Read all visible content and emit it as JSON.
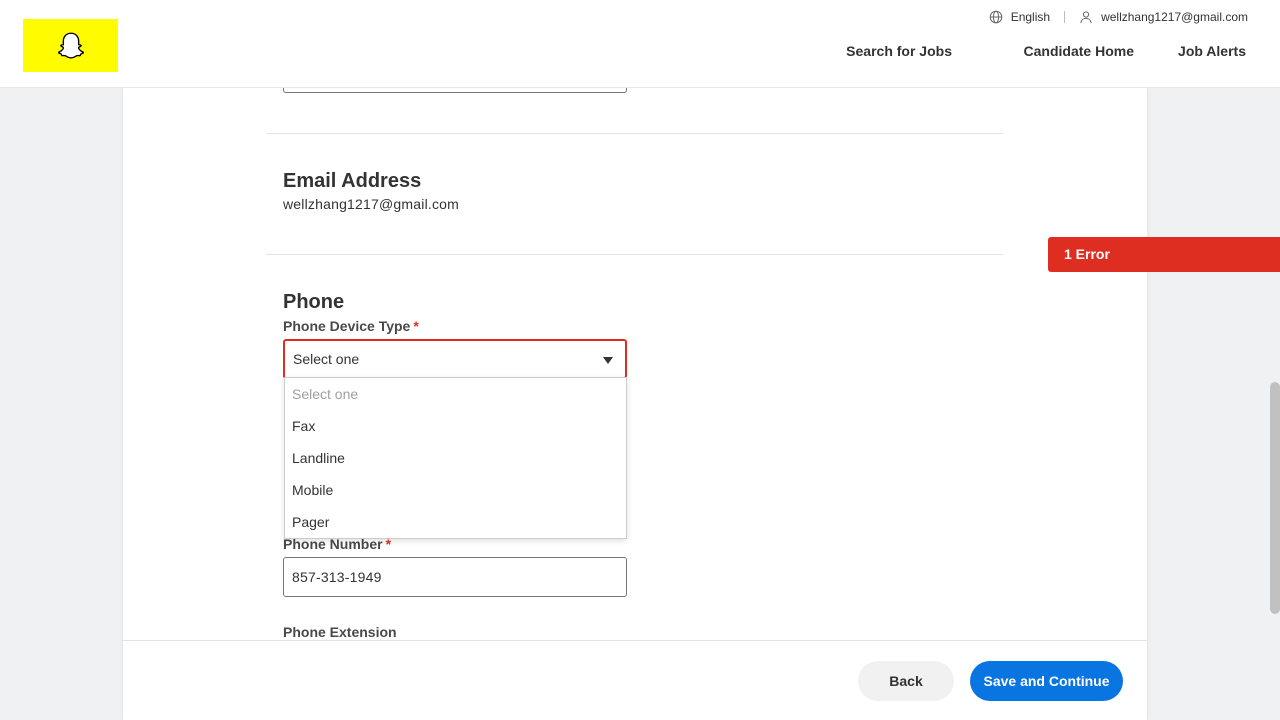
{
  "header": {
    "logo_alt": "Snapchat",
    "language": "English",
    "user_email": "wellzhang1217@gmail.com",
    "nav": {
      "search_jobs": "Search for Jobs",
      "candidate_home": "Candidate Home",
      "job_alerts": "Job Alerts"
    }
  },
  "email_section": {
    "title": "Email Address",
    "value": "wellzhang1217@gmail.com"
  },
  "phone_section": {
    "title": "Phone",
    "device_type": {
      "label": "Phone Device Type",
      "required_mark": "*",
      "selected": "Select one",
      "options": [
        "Select one",
        "Fax",
        "Landline",
        "Mobile",
        "Pager"
      ]
    },
    "number": {
      "label": "Phone Number",
      "required_mark": "*",
      "value": "857-313-1949"
    },
    "extension": {
      "label": "Phone Extension"
    }
  },
  "error_badge": {
    "text": "1 Error"
  },
  "footer": {
    "back_label": "Back",
    "save_label": "Save and Continue"
  },
  "colors": {
    "brand_yellow": "#fffc00",
    "error_red": "#de2e21",
    "primary_blue": "#0875e1"
  }
}
